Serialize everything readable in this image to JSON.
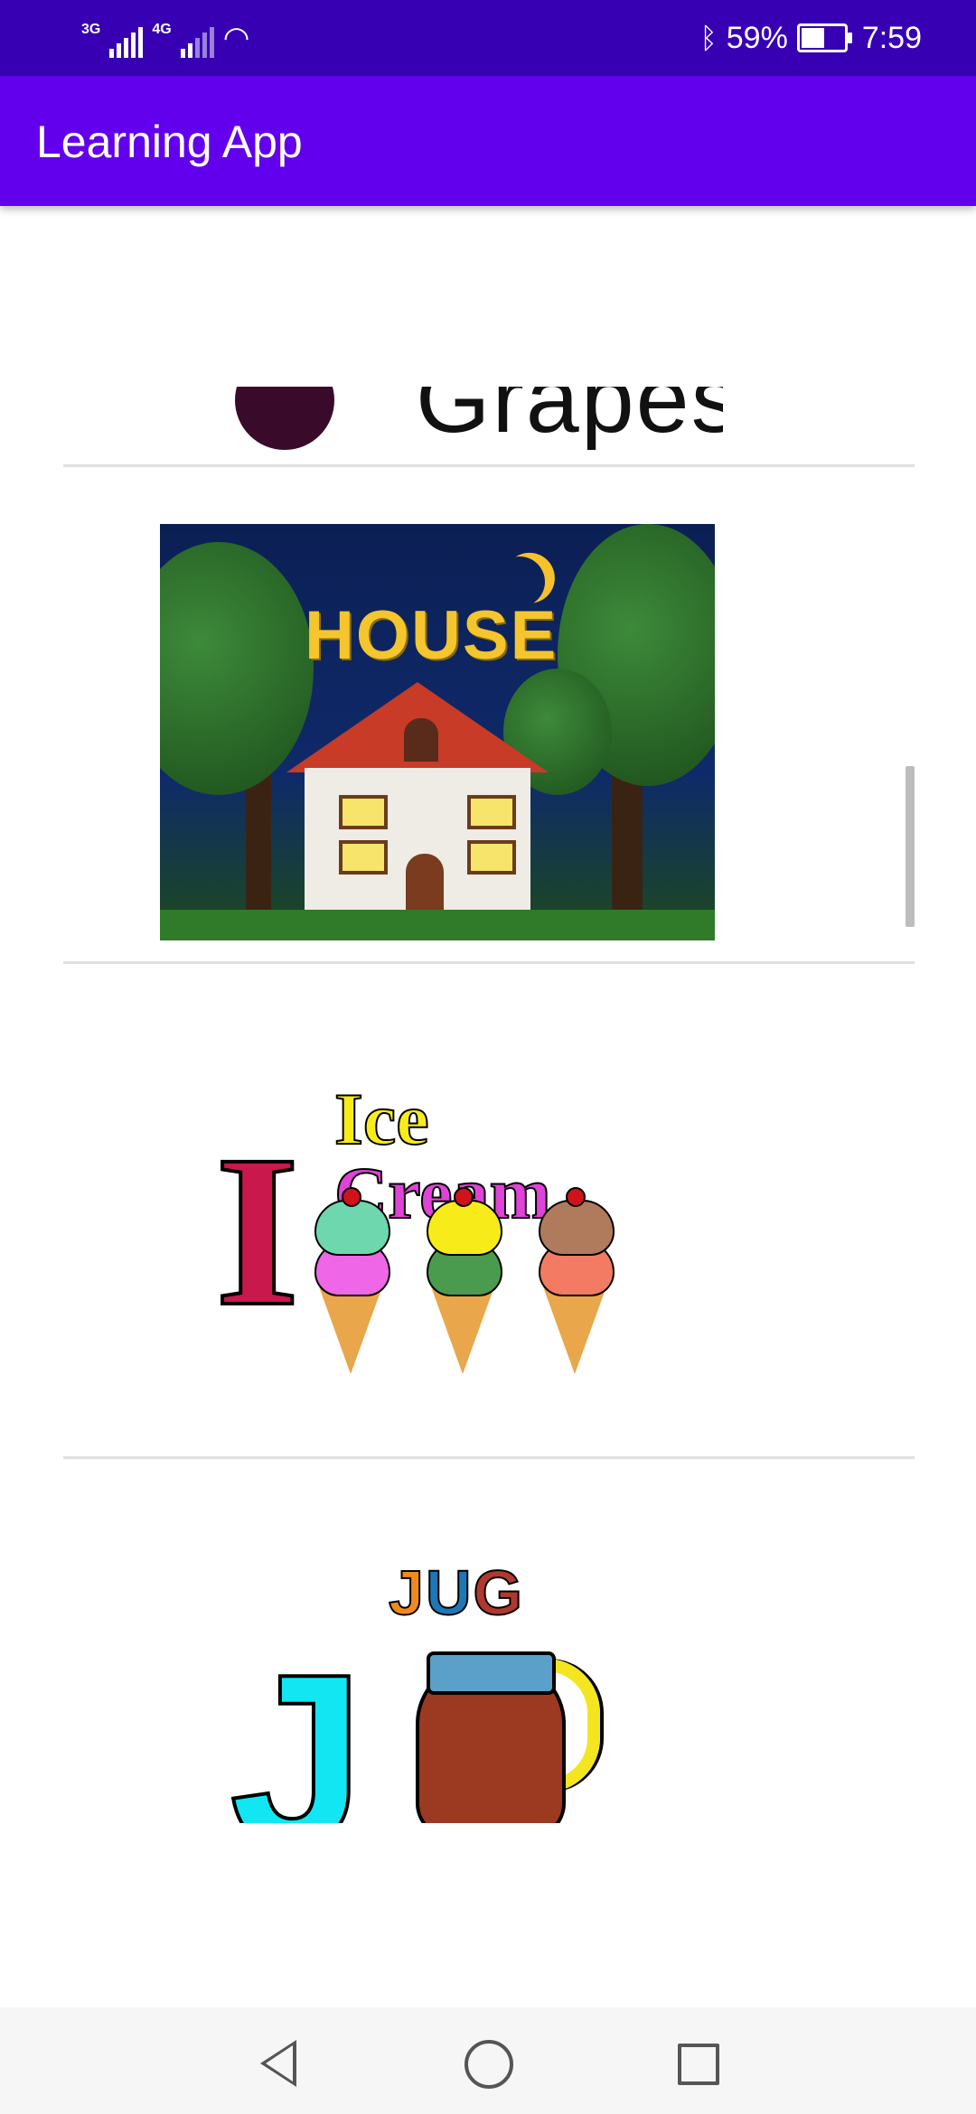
{
  "status_bar": {
    "network_1": "3G",
    "network_2": "4G",
    "battery_percent": "59%",
    "battery_level": 0.59,
    "time": "7:59"
  },
  "app_bar": {
    "title": "Learning App"
  },
  "list": {
    "items": [
      {
        "label": "Grapes"
      },
      {
        "label": "HOUSE"
      },
      {
        "letter": "I",
        "label_word1": "Ice",
        "label_word2": "Cream"
      },
      {
        "letter": "J",
        "label_j": "J",
        "label_u": "U",
        "label_g": "G"
      }
    ]
  },
  "colors": {
    "status_bar": "#3700B3",
    "app_bar": "#6200EE"
  },
  "nav": {
    "back": "back-icon",
    "home": "home-icon",
    "recent": "recent-apps-icon"
  }
}
